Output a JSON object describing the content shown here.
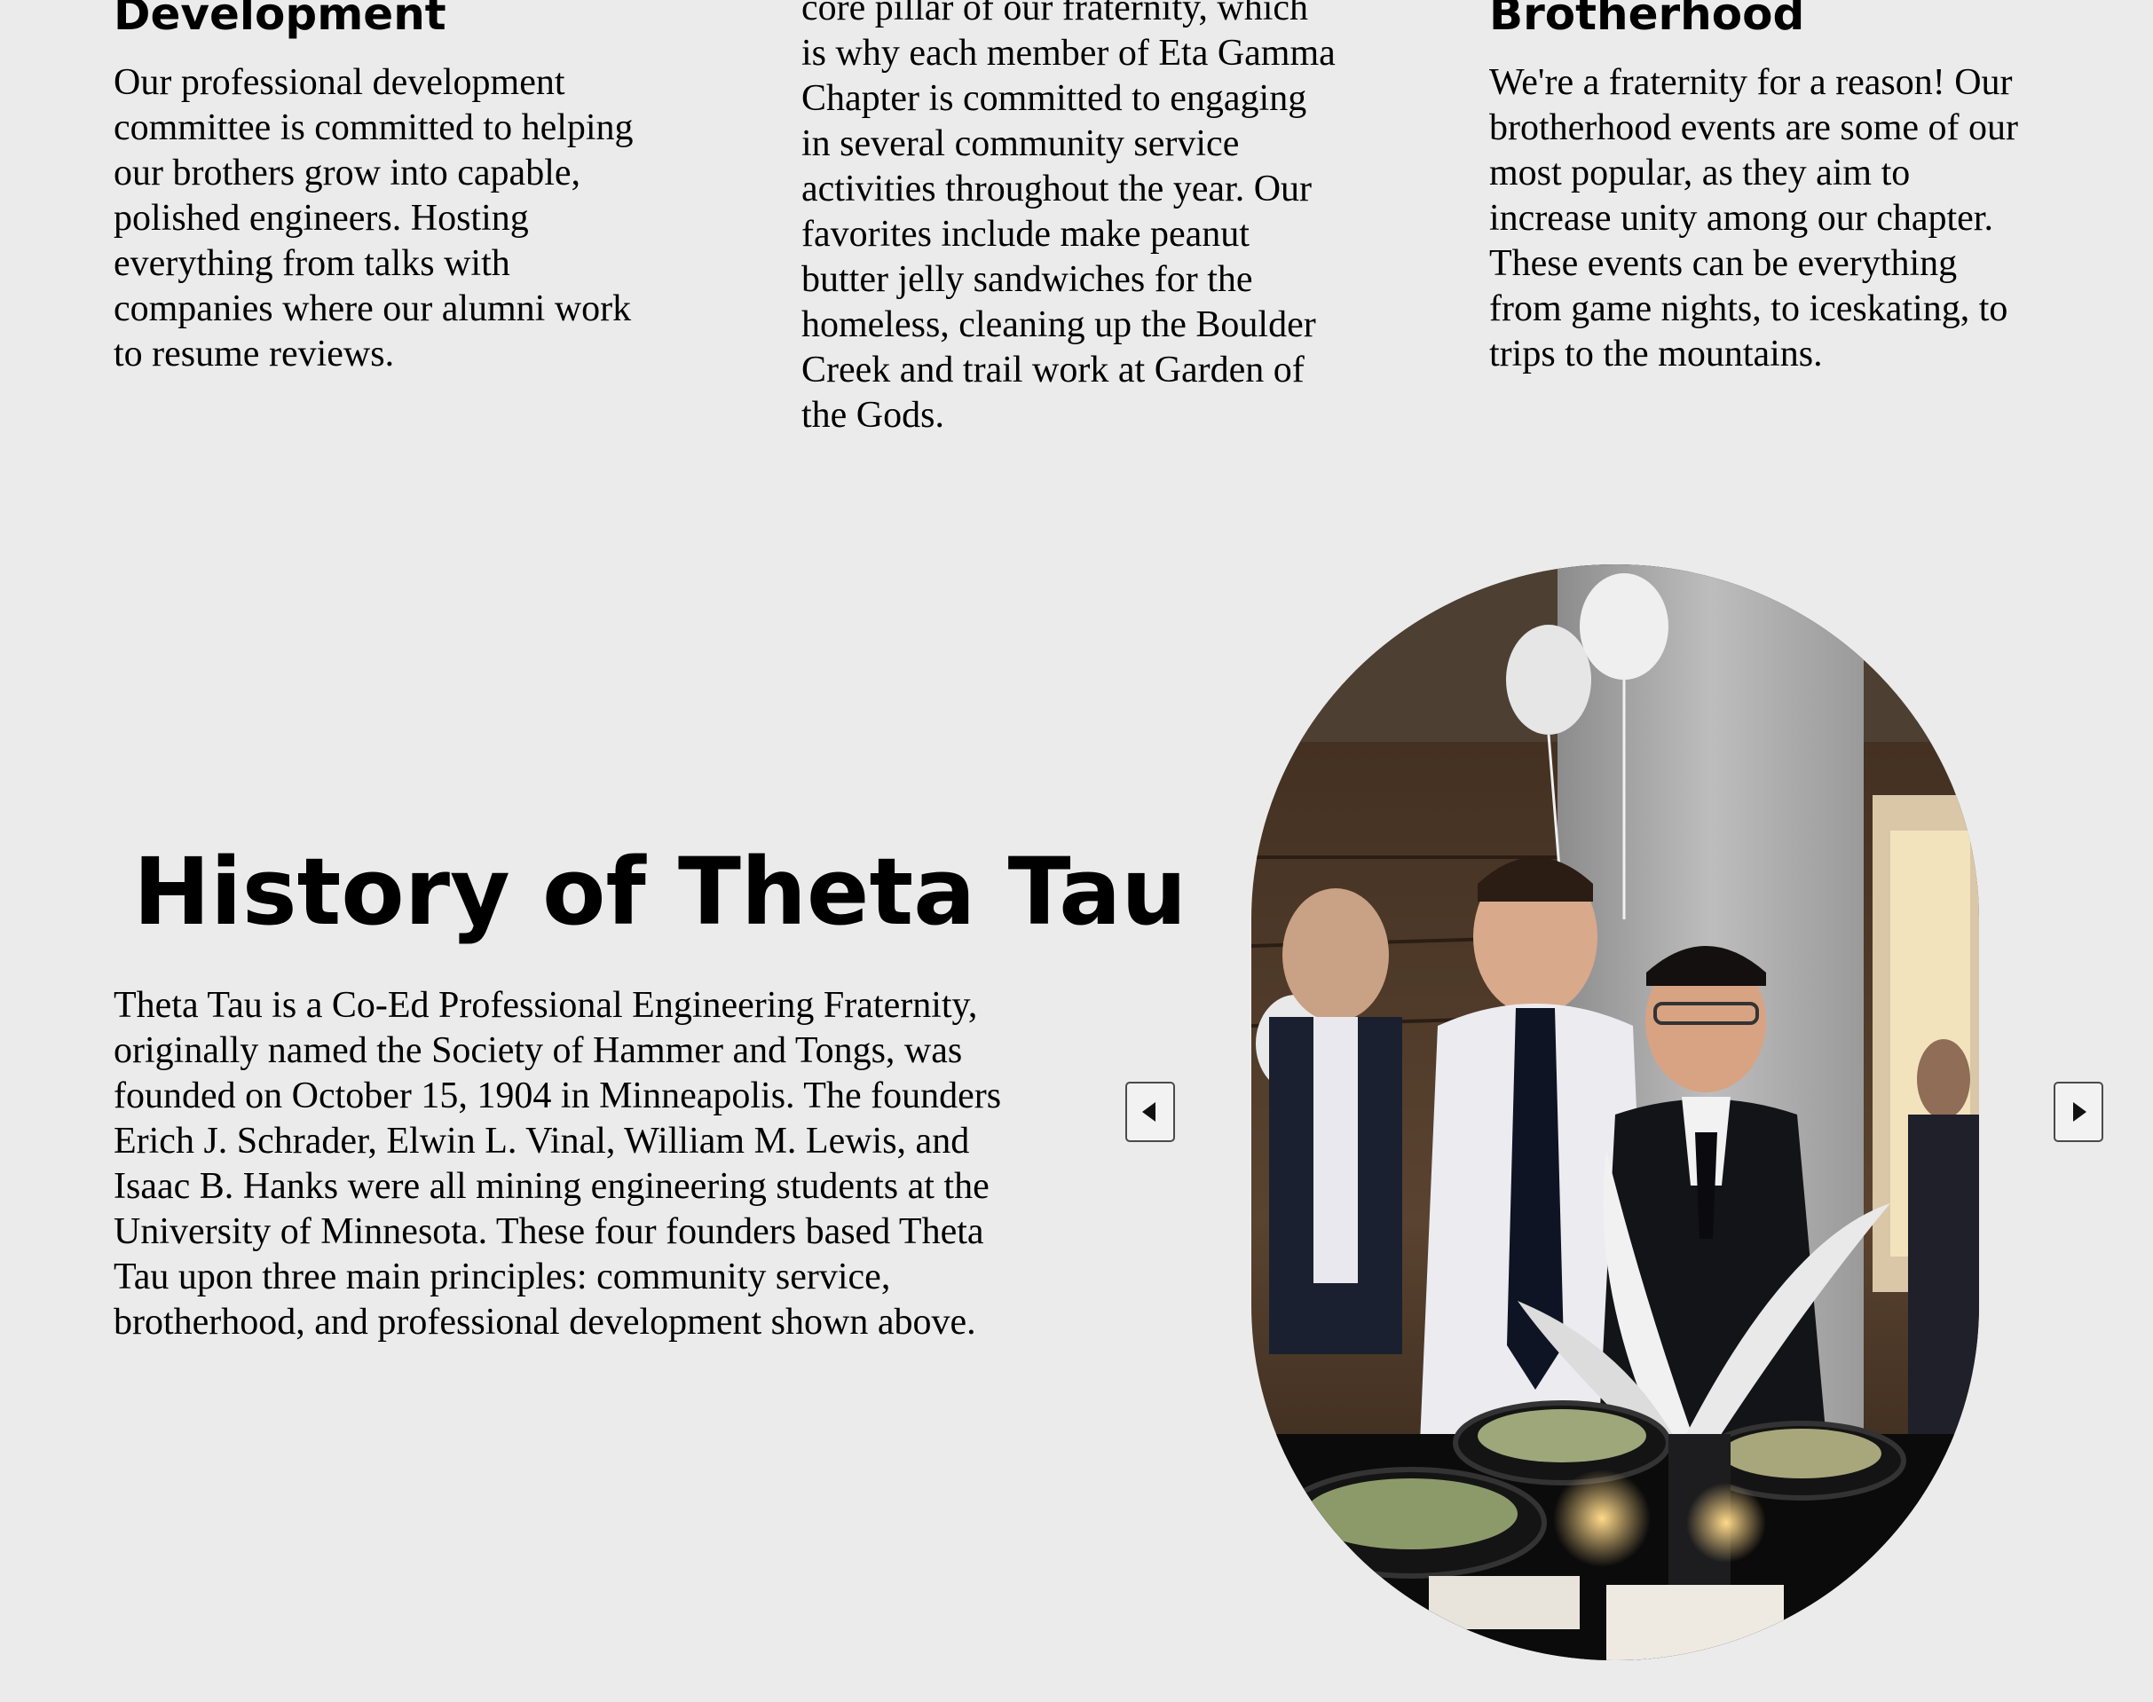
{
  "columns": [
    {
      "title": "Development",
      "text": "Our professional development\ncommittee is committed to helping\nour brothers grow into capable,\npolished engineers. Hosting\neverything from talks with\ncompanies where our alumni work\nto resume reviews."
    },
    {
      "title": "",
      "text": "core pillar of our fraternity, which\nis why each member of Eta Gamma\nChapter is committed to engaging\nin several community service\nactivities throughout the year. Our\nfavorites include make peanut\nbutter jelly sandwiches for the\nhomeless, cleaning up the Boulder\nCreek and trail work at Garden of\nthe Gods."
    },
    {
      "title": "Brotherhood",
      "text": "We're a fraternity for a reason! Our\nbrotherhood events are some of our\nmost popular, as they aim to\nincrease unity among our chapter.\nThese events can be everything\nfrom game nights, to iceskating, to\ntrips to the mountains."
    }
  ],
  "history": {
    "title": "History of Theta Tau",
    "text": "Theta Tau is a Co-Ed Professional Engineering Fraternity,\noriginally named the Society of Hammer and Tongs, was\nfounded on October 15, 1904 in Minneapolis. The founders\nErich J. Schrader, Elwin L. Vinal, William M. Lewis, and\nIsaac B. Hanks were all mining engineering students at the\nUniversity of Minnesota. These four founders based Theta\nTau upon three main principles: community service,\nbrotherhood, and professional development shown above."
  },
  "carousel": {
    "prev_icon": "triangle-left-icon",
    "next_icon": "triangle-right-icon"
  },
  "colors": {
    "background": "#ebebeb",
    "text": "#000000",
    "button_border": "#4a4a4a"
  }
}
